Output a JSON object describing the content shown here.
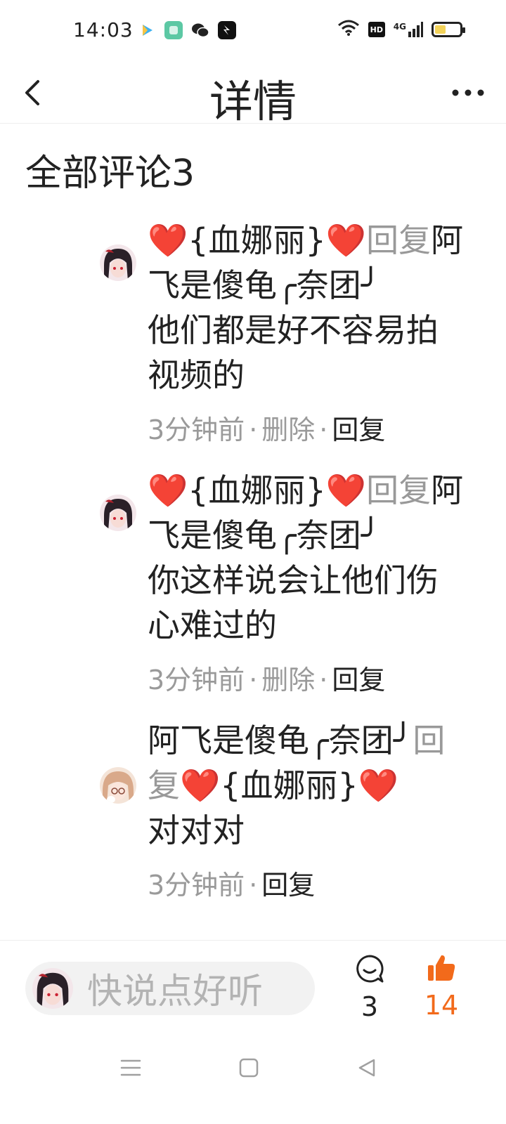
{
  "status_bar": {
    "time": "14:03",
    "hd": "HD",
    "network": "4G"
  },
  "header": {
    "title": "详情"
  },
  "section": {
    "title": "全部评论3"
  },
  "comments": [
    {
      "heart": "❤️",
      "user": "{血娜丽}",
      "reply_word": "回复",
      "target_user": "阿飞是傻龟╭奈团╯",
      "text": "他们都是好不容易拍视频的",
      "time": "3分钟前",
      "delete": "删除",
      "reply": "回复"
    },
    {
      "heart": "❤️",
      "user": "{血娜丽}",
      "reply_word": "回复",
      "target_user": "阿飞是傻龟╭奈团╯",
      "text": "你这样说会让他们伤心难过的",
      "time": "3分钟前",
      "delete": "删除",
      "reply": "回复"
    },
    {
      "user": "阿飞是傻龟╭奈团╯",
      "reply_word": "回复",
      "heart": "❤️",
      "target_user": "{血娜丽}",
      "text": "对对对",
      "time": "3分钟前",
      "reply": "回复"
    }
  ],
  "bottom_bar": {
    "placeholder": "快说点好听",
    "comment_count": "3",
    "like_count": "14"
  },
  "colors": {
    "heart": "#e02424",
    "like": "#f26a1b",
    "muted": "#9a9a9a"
  }
}
